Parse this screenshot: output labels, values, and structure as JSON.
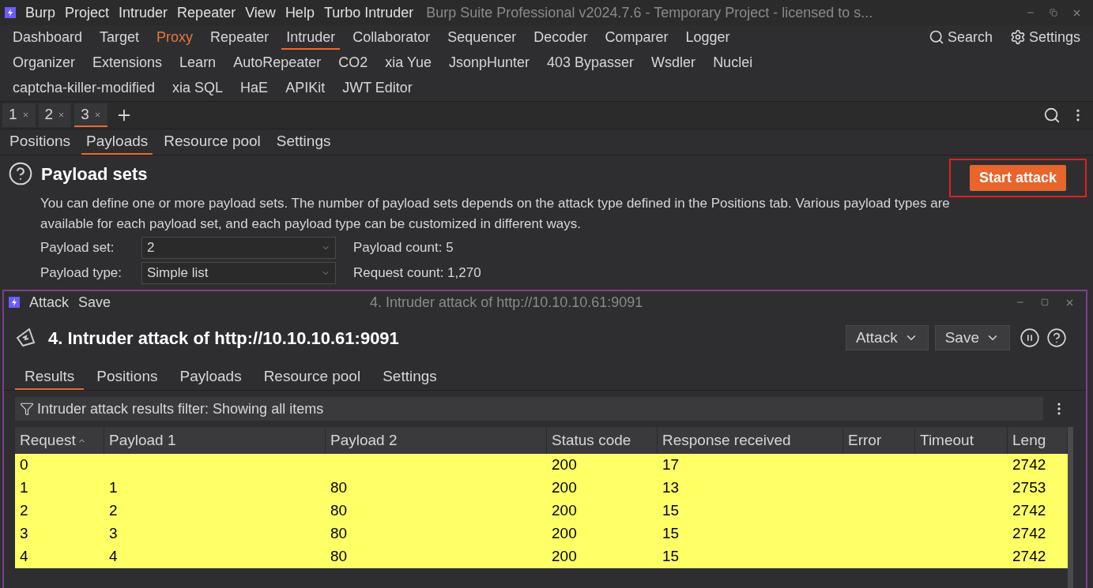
{
  "window": {
    "menu": [
      "Burp",
      "Project",
      "Intruder",
      "Repeater",
      "View",
      "Help",
      "Turbo Intruder"
    ],
    "title": "Burp Suite Professional v2024.7.6 - Temporary Project - licensed to s..."
  },
  "nav_rows": [
    [
      {
        "label": "Dashboard",
        "selected": false,
        "alert": false,
        "kind": "text"
      },
      {
        "label": "Target",
        "selected": false,
        "alert": false,
        "kind": "text"
      },
      {
        "label": "Proxy",
        "selected": false,
        "alert": true,
        "kind": "text"
      },
      {
        "label": "Repeater",
        "selected": false,
        "alert": false,
        "kind": "text"
      },
      {
        "label": "Intruder",
        "selected": true,
        "alert": false,
        "kind": "text"
      },
      {
        "label": "Collaborator",
        "selected": false,
        "alert": false,
        "kind": "text"
      },
      {
        "label": "Sequencer",
        "selected": false,
        "alert": false,
        "kind": "text"
      },
      {
        "label": "Decoder",
        "selected": false,
        "alert": false,
        "kind": "text"
      },
      {
        "label": "Comparer",
        "selected": false,
        "alert": false,
        "kind": "text"
      },
      {
        "label": "Logger",
        "selected": false,
        "alert": false,
        "kind": "text"
      },
      {
        "label": "Search",
        "selected": false,
        "alert": false,
        "kind": "search"
      },
      {
        "label": "Settings",
        "selected": false,
        "alert": false,
        "kind": "settings"
      }
    ],
    [
      {
        "label": "Organizer",
        "selected": false,
        "alert": false,
        "kind": "text"
      },
      {
        "label": "Extensions",
        "selected": false,
        "alert": false,
        "kind": "text"
      },
      {
        "label": "Learn",
        "selected": false,
        "alert": false,
        "kind": "text"
      },
      {
        "label": "AutoRepeater",
        "selected": false,
        "alert": false,
        "kind": "text"
      },
      {
        "label": "CO2",
        "selected": false,
        "alert": false,
        "kind": "text"
      },
      {
        "label": "xia Yue",
        "selected": false,
        "alert": false,
        "kind": "text"
      },
      {
        "label": "JsonpHunter",
        "selected": false,
        "alert": false,
        "kind": "text"
      },
      {
        "label": "403 Bypasser",
        "selected": false,
        "alert": false,
        "kind": "text"
      },
      {
        "label": "Wsdler",
        "selected": false,
        "alert": false,
        "kind": "text"
      },
      {
        "label": "Nuclei",
        "selected": false,
        "alert": false,
        "kind": "text"
      }
    ],
    [
      {
        "label": "captcha-killer-modified",
        "selected": false,
        "alert": false,
        "kind": "text"
      },
      {
        "label": "xia SQL",
        "selected": false,
        "alert": false,
        "kind": "text"
      },
      {
        "label": "HaE",
        "selected": false,
        "alert": false,
        "kind": "text"
      },
      {
        "label": "APIKit",
        "selected": false,
        "alert": false,
        "kind": "text"
      },
      {
        "label": "JWT Editor",
        "selected": false,
        "alert": false,
        "kind": "text"
      }
    ]
  ],
  "attack_tabs": [
    {
      "label": "1",
      "selected": false
    },
    {
      "label": "2",
      "selected": false
    },
    {
      "label": "3",
      "selected": true
    }
  ],
  "sub_tabs": [
    {
      "label": "Positions",
      "selected": false
    },
    {
      "label": "Payloads",
      "selected": true
    },
    {
      "label": "Resource pool",
      "selected": false
    },
    {
      "label": "Settings",
      "selected": false
    }
  ],
  "payload_sets": {
    "title": "Payload sets",
    "start_button": "Start attack",
    "description": "You can define one or more payload sets. The number of payload sets depends on the attack type defined in the Positions tab. Various payload types are available for each payload set, and each payload type can be customized in different ways.",
    "rows": [
      {
        "label": "Payload set:",
        "value": "2",
        "info": "Payload count: 5"
      },
      {
        "label": "Payload type:",
        "value": "Simple list",
        "info": "Request count: 1,270"
      }
    ]
  },
  "attack_window": {
    "menu": [
      "Attack",
      "Save"
    ],
    "title": "4. Intruder attack of http://10.10.10.61:9091",
    "heading": "4. Intruder attack of http://10.10.10.61:9091",
    "buttons": [
      "Attack",
      "Save"
    ],
    "tabs": [
      {
        "label": "Results",
        "selected": true
      },
      {
        "label": "Positions",
        "selected": false
      },
      {
        "label": "Payloads",
        "selected": false
      },
      {
        "label": "Resource pool",
        "selected": false
      },
      {
        "label": "Settings",
        "selected": false
      }
    ],
    "filter": "Intruder attack results filter: Showing all items",
    "table": {
      "columns": [
        {
          "label": "Request",
          "sorted": true
        },
        {
          "label": "Payload 1",
          "sorted": false
        },
        {
          "label": "Payload 2",
          "sorted": false
        },
        {
          "label": "Status code",
          "sorted": false
        },
        {
          "label": "Response received",
          "sorted": false
        },
        {
          "label": "Error",
          "sorted": false
        },
        {
          "label": "Timeout",
          "sorted": false
        },
        {
          "label": "Leng",
          "sorted": false
        }
      ],
      "rows": [
        [
          "0",
          "",
          "",
          "200",
          "17",
          "",
          "",
          "2742"
        ],
        [
          "1",
          "1",
          "80",
          "200",
          "13",
          "",
          "",
          "2753"
        ],
        [
          "2",
          "2",
          "80",
          "200",
          "15",
          "",
          "",
          "2742"
        ],
        [
          "3",
          "3",
          "80",
          "200",
          "15",
          "",
          "",
          "2742"
        ],
        [
          "4",
          "4",
          "80",
          "200",
          "15",
          "",
          "",
          "2742"
        ]
      ]
    }
  }
}
